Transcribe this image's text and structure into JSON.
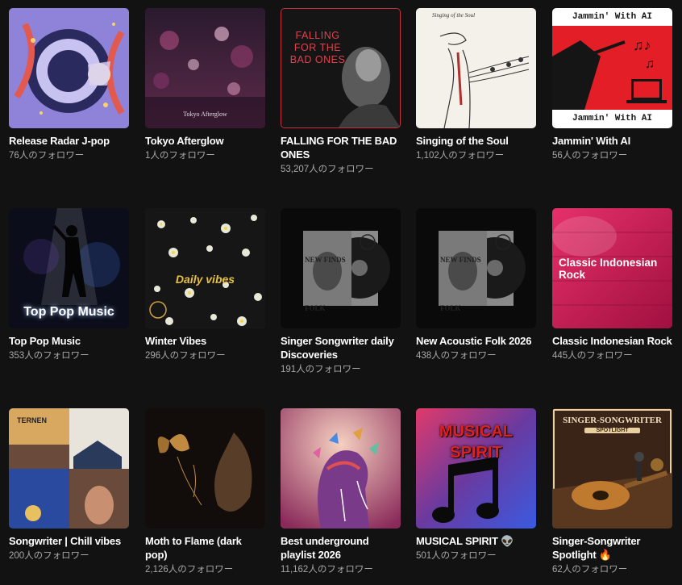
{
  "playlists": [
    {
      "title": "Release Radar J-pop",
      "followers": "76人のフォロワー",
      "cover_icon": "anime-illustration"
    },
    {
      "title": "Tokyo Afterglow",
      "followers": "1人のフォロワー",
      "cover_icon": "city-bokeh",
      "cover_text": "Tokyo Afterglow"
    },
    {
      "title": "FALLING FOR THE BAD ONES",
      "followers": "53,207人のフォロワー",
      "cover_icon": "portrait-red-text",
      "cover_text": "FALLING FOR THE BAD ONES"
    },
    {
      "title": "Singing of the Soul",
      "followers": "1,102人のフォロワー",
      "cover_icon": "line-drawing-singer",
      "cover_text": "Singing of the Soul"
    },
    {
      "title": "Jammin' With AI",
      "followers": "56人のフォロワー",
      "cover_icon": "conductor-laptop",
      "cover_text": "Jammin' With AI"
    },
    {
      "title": "Top Pop Music",
      "followers": "353人のフォロワー",
      "cover_icon": "neon-silhouette",
      "cover_text": "Top Pop Music"
    },
    {
      "title": "Winter Vibes",
      "followers": "296人のフォロワー",
      "cover_icon": "flowers-dark",
      "cover_text": "Daily vibes"
    },
    {
      "title": "Singer Songwriter daily Discoveries",
      "followers": "191人のフォロワー",
      "cover_icon": "vinyl-new-finds",
      "cover_text": "NEW FINDS FOLK"
    },
    {
      "title": "New Acoustic Folk 2026",
      "followers": "438人のフォロワー",
      "cover_icon": "vinyl-new-finds",
      "cover_text": "NEW FINDS FOLK"
    },
    {
      "title": "Classic Indonesian Rock",
      "followers": "445人のフォロワー",
      "cover_icon": "pink-wall",
      "cover_text": "Classic Indonesian Rock"
    },
    {
      "title": "Songwriter | Chill vibes",
      "followers": "200人のフォロワー",
      "cover_icon": "album-collage",
      "cover_text": "TERNEN"
    },
    {
      "title": "Moth to Flame (dark pop)",
      "followers": "2,126人のフォロワー",
      "cover_icon": "moth-face"
    },
    {
      "title": "Best underground playlist 2026",
      "followers": "11,162人のフォロワー",
      "cover_icon": "head-butterflies"
    },
    {
      "title": "MUSICAL SPIRIT 👽",
      "followers": "501人のフォロワー",
      "cover_icon": "music-note-smoke",
      "cover_text": "MUSICAL SPIRIT"
    },
    {
      "title": "Singer-Songwriter Spotlight 🔥",
      "followers": "62人のフォロワー",
      "cover_icon": "guitar-spotlight",
      "cover_text": "SINGER-SONGWRITER",
      "cover_subtext": "SPOTLIGHT"
    }
  ]
}
